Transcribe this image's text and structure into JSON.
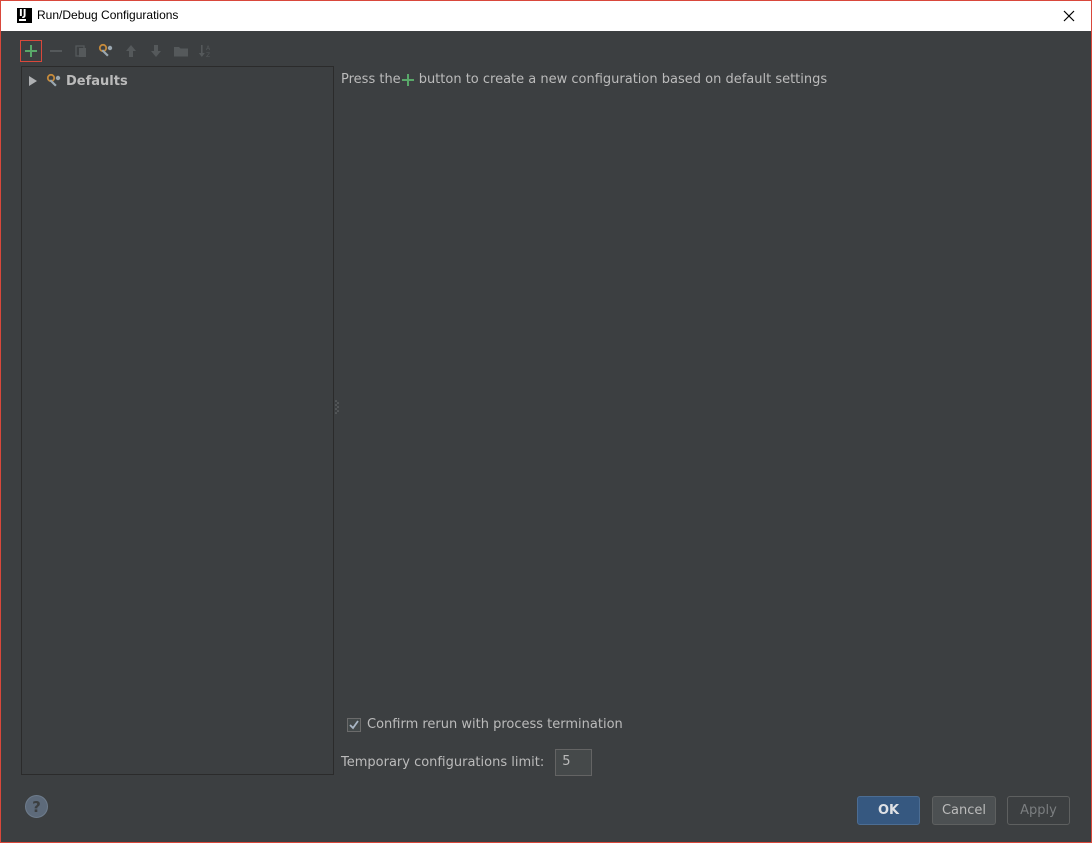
{
  "window": {
    "title": "Run/Debug Configurations",
    "close_glyph": "✕",
    "app_icon_glyph": "IJ"
  },
  "toolbar": {
    "buttons": [
      {
        "name": "add",
        "icon": "plus-icon"
      },
      {
        "name": "remove",
        "icon": "minus-icon"
      },
      {
        "name": "copy",
        "icon": "copy-icon"
      },
      {
        "name": "edit-defaults",
        "icon": "wrench-icon"
      },
      {
        "name": "move-up",
        "icon": "arrow-up-icon"
      },
      {
        "name": "move-down",
        "icon": "arrow-down-icon"
      },
      {
        "name": "folder",
        "icon": "folder-icon"
      },
      {
        "name": "sort",
        "icon": "sort-alpha-icon"
      }
    ]
  },
  "tree": {
    "items": [
      {
        "label": "Defaults",
        "icon": "wrench-icon",
        "expanded": false
      }
    ]
  },
  "content": {
    "hint_prefix": "Press the",
    "hint_suffix": " button to create a new configuration based on default settings"
  },
  "options": {
    "confirm_rerun_label": "Confirm rerun with process termination",
    "confirm_rerun_checked": true,
    "temp_limit_label": "Temporary configurations limit:",
    "temp_limit_value": "5"
  },
  "buttons": {
    "help_glyph": "?",
    "ok": "OK",
    "cancel": "Cancel",
    "apply": "Apply"
  },
  "colors": {
    "background": "#3c3f41",
    "accent_green": "#59a869",
    "frame_red": "#d9483b",
    "ok_button": "#365880"
  }
}
